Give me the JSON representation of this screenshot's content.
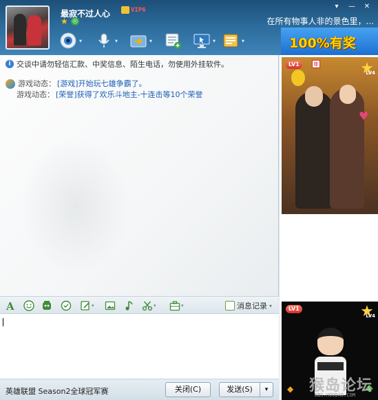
{
  "header": {
    "nickname": "最寂不过人心",
    "vip_label": "VIP6",
    "signature": "在所有物事人非的景色里，..."
  },
  "window_controls": [
    {
      "name": "settings-dropdown",
      "glyph": "▾"
    },
    {
      "name": "minimize",
      "glyph": "—"
    },
    {
      "name": "close",
      "glyph": "✕"
    }
  ],
  "toolbar_icons": [
    "video-call-icon",
    "voice-call-icon",
    "send-file-icon",
    "group-chat-icon",
    "remote-assist-icon",
    "apps-icon"
  ],
  "ad": {
    "text": "100%有奖"
  },
  "chat": {
    "notice": "交谈中请勿轻信汇款、中奖信息、陌生电话，勿使用外挂软件。",
    "feed": [
      {
        "label": "游戏动态：",
        "link": "[游戏]开始玩七雄争霸了。"
      },
      {
        "label": "游戏动态：",
        "link": "[荣誉]获得了欢乐斗地主-十连击等10个荣誉"
      }
    ]
  },
  "input_toolbar": {
    "history_label": "消息记录"
  },
  "footer": {
    "ad_text": "英雄联盟 Season2全球冠军赛",
    "close_button": "关闭(C)",
    "send_button": "发送(S)",
    "send_dropdown": "▾"
  },
  "right_panel": {
    "top_show": {
      "level_badge": "LV1",
      "year_badge": "年",
      "star_level": "LV4"
    },
    "bottom_show": {
      "level_badge": "LV1",
      "star_level": "LV4",
      "watermark": "猴岛论坛",
      "watermark_url": "BBS.HOUDAO.COM"
    }
  }
}
